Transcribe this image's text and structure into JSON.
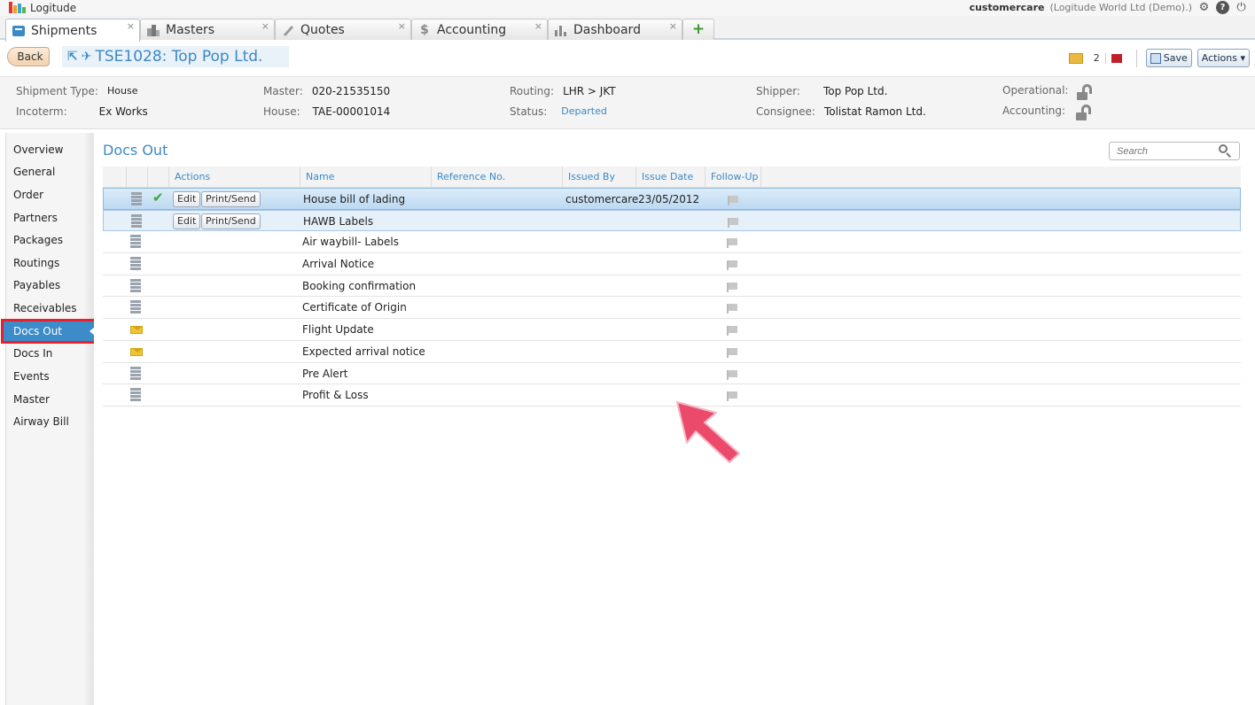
{
  "app": {
    "name": "Logitude"
  },
  "user": {
    "name": "customercare",
    "org": "(Logitude World Ltd (Demo).)"
  },
  "tabs": [
    {
      "label": "Shipments",
      "icon": "shipments-icon"
    },
    {
      "label": "Masters",
      "icon": "masters-icon"
    },
    {
      "label": "Quotes",
      "icon": "quotes-icon"
    },
    {
      "label": "Accounting",
      "icon": "accounting-icon"
    },
    {
      "label": "Dashboard",
      "icon": "dashboard-icon"
    }
  ],
  "tab_close": "×",
  "tab_add": "+",
  "toolbar": {
    "back_label": "Back",
    "title": "TSE1028: Top Pop Ltd.",
    "flag_count": "2",
    "save_label": "Save",
    "actions_label": "Actions ▾"
  },
  "info": {
    "shipment_type_label": "Shipment Type:",
    "shipment_type": "House",
    "incoterm_label": "Incoterm:",
    "incoterm": "Ex Works",
    "master_label": "Master:",
    "master": "020-21535150",
    "house_label": "House:",
    "house": "TAE-00001014",
    "routing_label": "Routing:",
    "routing": "LHR > JKT",
    "status_label": "Status:",
    "status": "Departed",
    "shipper_label": "Shipper:",
    "shipper": "Top Pop Ltd.",
    "consignee_label": "Consignee:",
    "consignee": "Tolistat Ramon Ltd.",
    "operational_label": "Operational:",
    "accounting_label": "Accounting:"
  },
  "sidebar": {
    "items": [
      "Overview",
      "General",
      "Order",
      "Partners",
      "Packages",
      "Routings",
      "Payables",
      "Receivables",
      "Docs Out",
      "Docs In",
      "Events",
      "Master",
      "Airway Bill"
    ],
    "active": "Docs Out"
  },
  "main": {
    "title": "Docs Out",
    "search_placeholder": "Search",
    "columns": [
      "Actions",
      "Name",
      "Reference No.",
      "Issued By",
      "Issue Date",
      "Follow-Up"
    ],
    "edit_label": "Edit",
    "print_label": "Print/Send",
    "rows": [
      {
        "icon": "stack",
        "checked": true,
        "buttons": true,
        "name": "House bill of lading",
        "ref": "",
        "issued_by": "customercare",
        "issue_date": "23/05/2012",
        "state": "selected"
      },
      {
        "icon": "stack",
        "checked": false,
        "buttons": true,
        "name": "HAWB Labels",
        "ref": "",
        "issued_by": "",
        "issue_date": "",
        "state": "hover"
      },
      {
        "icon": "stack",
        "checked": false,
        "buttons": false,
        "name": "Air waybill- Labels",
        "ref": "",
        "issued_by": "",
        "issue_date": "",
        "state": ""
      },
      {
        "icon": "stack",
        "checked": false,
        "buttons": false,
        "name": "Arrival Notice",
        "ref": "",
        "issued_by": "",
        "issue_date": "",
        "state": ""
      },
      {
        "icon": "stack",
        "checked": false,
        "buttons": false,
        "name": "Booking confirmation",
        "ref": "",
        "issued_by": "",
        "issue_date": "",
        "state": ""
      },
      {
        "icon": "stack",
        "checked": false,
        "buttons": false,
        "name": "Certificate of Origin",
        "ref": "",
        "issued_by": "",
        "issue_date": "",
        "state": ""
      },
      {
        "icon": "envelope",
        "checked": false,
        "buttons": false,
        "name": "Flight Update",
        "ref": "",
        "issued_by": "",
        "issue_date": "",
        "state": ""
      },
      {
        "icon": "envelope",
        "checked": false,
        "buttons": false,
        "name": "Expected arrival notice",
        "ref": "",
        "issued_by": "",
        "issue_date": "",
        "state": ""
      },
      {
        "icon": "stack",
        "checked": false,
        "buttons": false,
        "name": "Pre Alert",
        "ref": "",
        "issued_by": "",
        "issue_date": "",
        "state": ""
      },
      {
        "icon": "stack",
        "checked": false,
        "buttons": false,
        "name": "Profit & Loss",
        "ref": "",
        "issued_by": "",
        "issue_date": "",
        "state": ""
      }
    ]
  },
  "colors": {
    "accent": "#3b89c6",
    "highlight_border": "#e8202e",
    "pointer": "#ec4a6a"
  }
}
